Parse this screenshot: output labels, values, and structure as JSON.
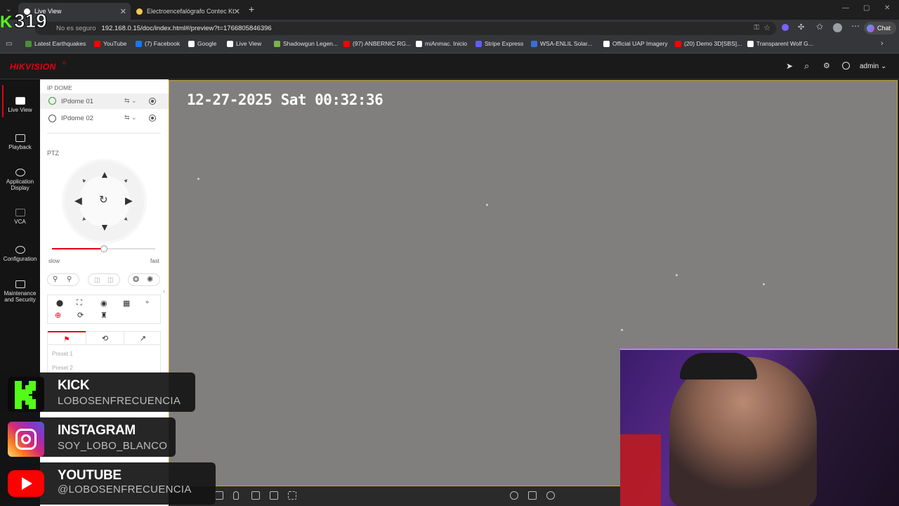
{
  "browser": {
    "kick_badge": "319",
    "tabs": [
      {
        "title": "Live View",
        "active": true
      },
      {
        "title": "Electroencefalógrafo Contec Kt88",
        "active": false
      }
    ],
    "new_tab": "+",
    "address": {
      "security": "No es seguro",
      "url": "192.168.0.15/doc/index.html#/preview?t=1766805846396"
    },
    "chat_label": "Chat",
    "bookmarks": [
      {
        "label": "Latest Earthquakes",
        "color": "#4a8f3a"
      },
      {
        "label": "YouTube",
        "color": "#ff0000"
      },
      {
        "label": "(7) Facebook",
        "color": "#1877f2"
      },
      {
        "label": "Google",
        "color": "#ffffff"
      },
      {
        "label": "Live View",
        "color": "#ffffff"
      },
      {
        "label": "Shadowgun Legen...",
        "color": "#7ab24c"
      },
      {
        "label": "(97) ANBERNIC RG...",
        "color": "#ff0000"
      },
      {
        "label": "miAnmac. Inicio",
        "color": "#ffffff"
      },
      {
        "label": "Stripe Express",
        "color": "#635bff"
      },
      {
        "label": "WSA-ENLIL Solar...",
        "color": "#3b6fd1"
      },
      {
        "label": "Official UAP Imagery",
        "color": "#ffffff"
      },
      {
        "label": "(20) Demo 3D[SBS]...",
        "color": "#ff0000"
      },
      {
        "label": "Transparent Wolf G...",
        "color": "#ffffff"
      }
    ]
  },
  "app": {
    "brand": "HIKVISION",
    "brand_color": "#e60012",
    "user": "admin",
    "nav": [
      {
        "label": "Live View",
        "active": true
      },
      {
        "label": "Playback"
      },
      {
        "label": "Application Display"
      },
      {
        "label": "VCA"
      },
      {
        "label": "Configuration"
      },
      {
        "label": "Maintenance and Security"
      }
    ],
    "device_group": "IP DOME",
    "cameras": [
      {
        "name": "IPdome 01",
        "selected": true
      },
      {
        "name": "IPdome 02",
        "selected": false
      }
    ],
    "ptz": {
      "title": "PTZ",
      "speed_fraction": 0.5,
      "slow_label": "slow",
      "fast_label": "fast",
      "presets": [
        "Preset 1",
        "Preset 2"
      ]
    },
    "osd_timestamp": "12-27-2025 Sat 00:32:36"
  },
  "overlays": [
    {
      "platform": "KICK",
      "handle": "LOBOSENFRECUENCIA",
      "color": "#53fc18"
    },
    {
      "platform": "INSTAGRAM",
      "handle": "SOY_LOBO_BLANCO",
      "color": "#d62976"
    },
    {
      "platform": "YOUTUBE",
      "handle": "@LOBOSENFRECUENCIA",
      "color": "#ff0000"
    }
  ]
}
